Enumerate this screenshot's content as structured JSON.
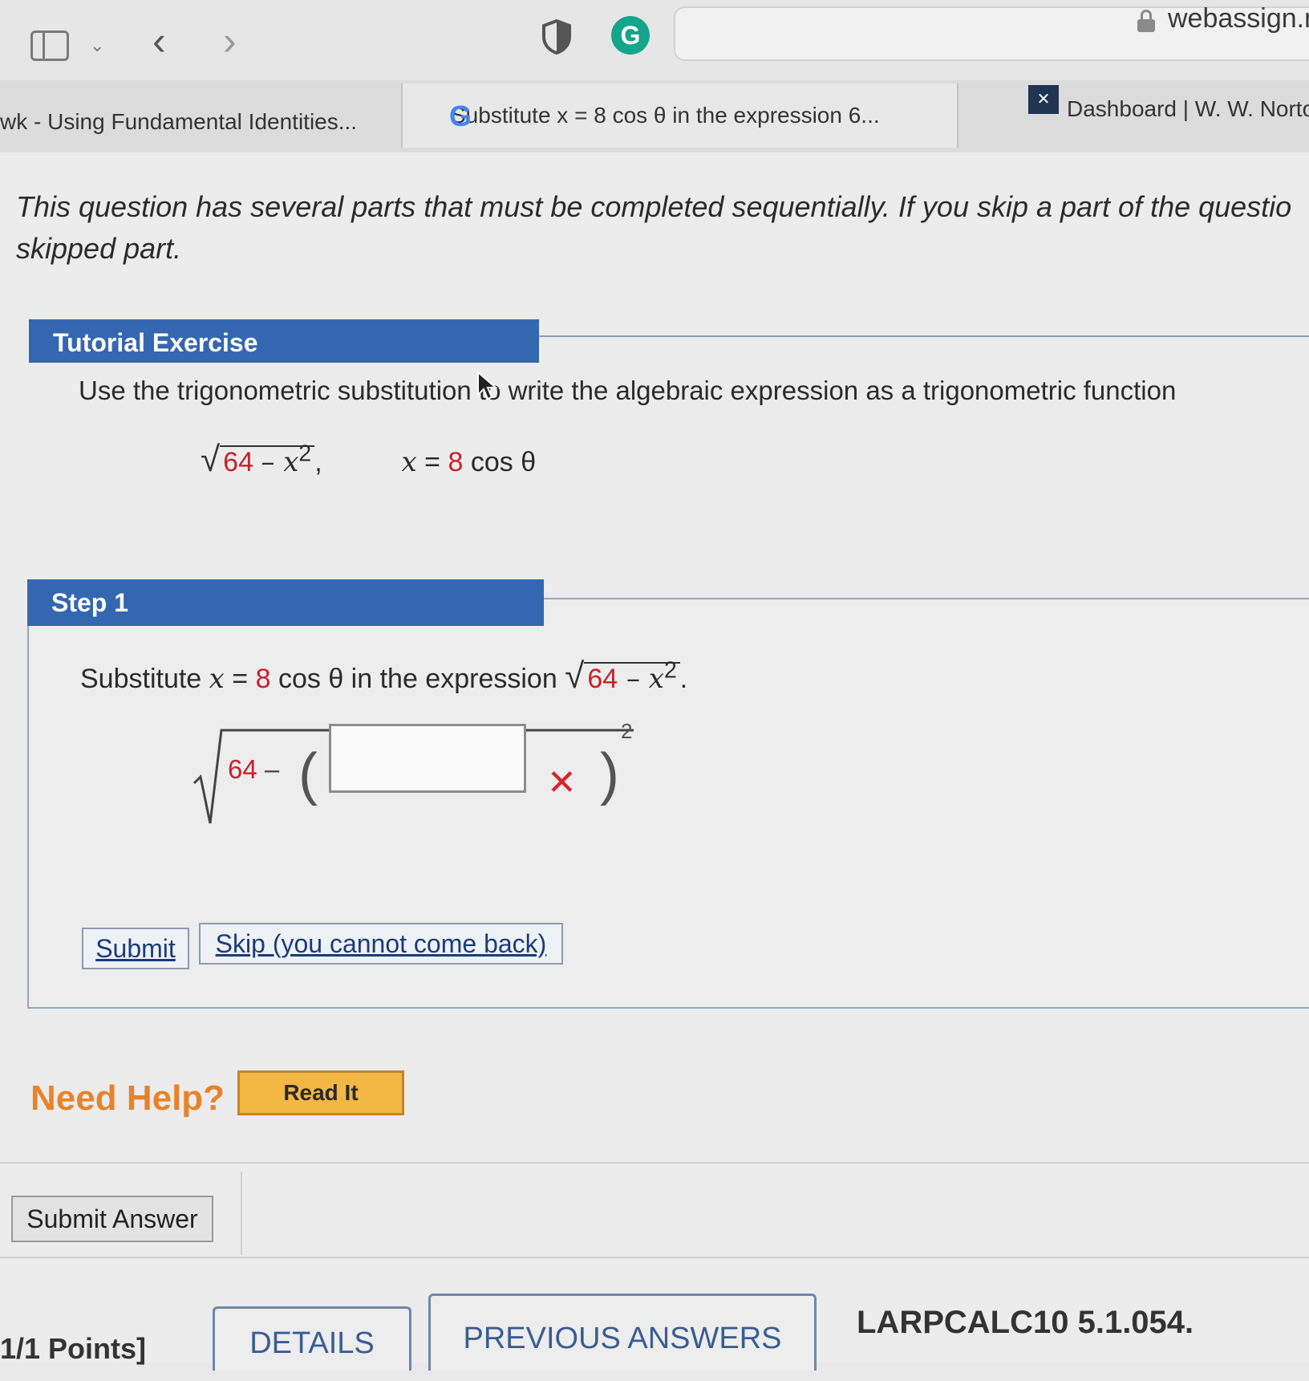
{
  "browser": {
    "domain": "webassign.n",
    "tabs": [
      {
        "label": "wk - Using Fundamental Identities..."
      },
      {
        "label": "Substitute x = 8 cos θ in the expression 6..."
      },
      {
        "label": "Dashboard | W. W. Norto"
      }
    ]
  },
  "page": {
    "intro_note": "This question has several parts that must be completed sequentially. If you skip a part of the questio skipped part.",
    "tutorial": {
      "header": "Tutorial Exercise",
      "instruction": "Use the trigonometric substitution to write the algebraic expression as a trigonometric function",
      "expr_radicand_const": "64",
      "expr_radicand_rest": "– x",
      "expr_exp": "2",
      "expr_comma": ",",
      "sub_var": "x",
      "sub_eq": " = ",
      "sub_coef": "8",
      "sub_func": " cos θ"
    },
    "step": {
      "header": "Step 1",
      "instr_prefix": "Substitute ",
      "instr_var": "x",
      "instr_eq": " = ",
      "instr_coef": "8",
      "instr_func": " cos θ",
      "instr_mid": "  in the expression ",
      "instr_const": "64",
      "instr_rest": " – x",
      "instr_exp": "2",
      "instr_end": ".",
      "radicand_const": "64",
      "minus": " –",
      "answer_value": "",
      "exponent": "2",
      "submit_label": "Submit",
      "skip_label": "Skip (you cannot come back)"
    },
    "help": {
      "label": "Need Help?",
      "read_it": "Read It"
    },
    "submit_answer": "Submit Answer",
    "footer": {
      "points": "1/1 Points]",
      "details": "DETAILS",
      "previous_answers": "PREVIOUS ANSWERS",
      "problem_id": "LARPCALC10 5.1.054."
    }
  },
  "colors": {
    "header_blue": "#3467b0",
    "math_red": "#c9212b",
    "help_orange": "#e8832b",
    "read_it_bg": "#f3b744",
    "wrong_red": "#d9242b"
  },
  "icons": [
    "sidebar-icon",
    "chevron-down-icon",
    "back-icon",
    "forward-icon",
    "shield-icon",
    "grammarly-icon",
    "lock-icon",
    "google-icon",
    "norton-logo-icon",
    "wrong-answer-icon",
    "cursor-icon"
  ]
}
